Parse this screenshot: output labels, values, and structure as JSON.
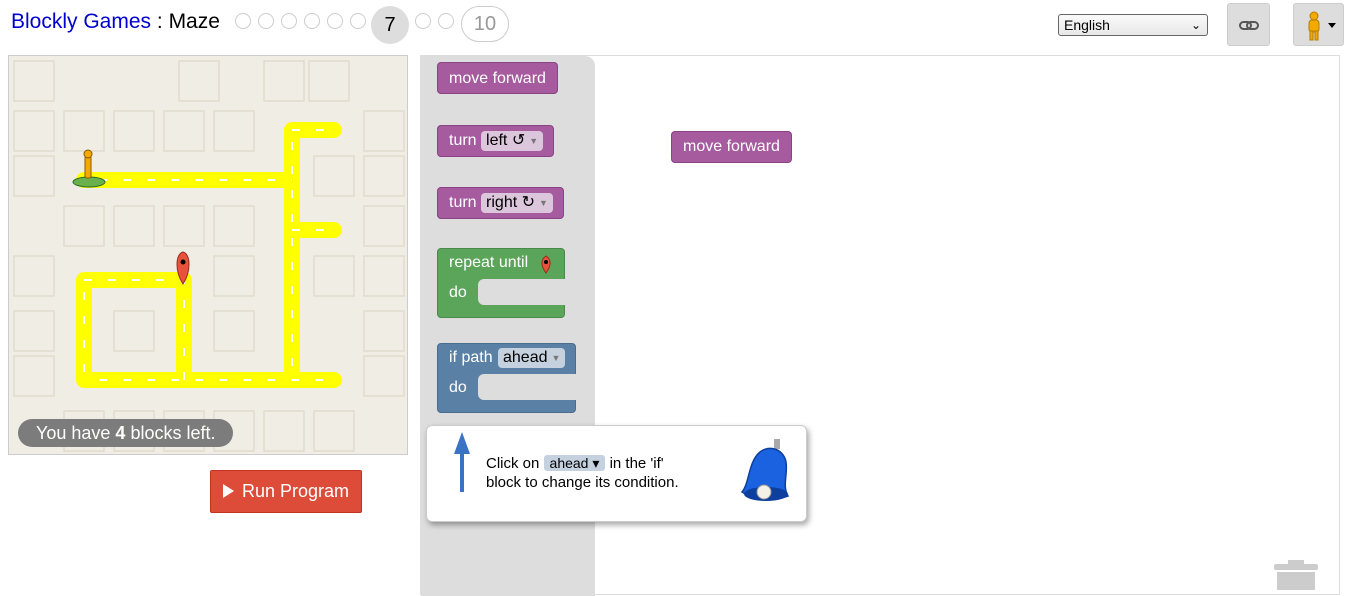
{
  "header": {
    "app_title": "Blockly Games",
    "separator": " : ",
    "game_name": "Maze",
    "current_level": "7",
    "last_level": "10",
    "language": "English"
  },
  "maze": {
    "capacity_prefix": "You have ",
    "capacity_count": "4",
    "capacity_suffix": " blocks left."
  },
  "run_button": {
    "label": "Run Program"
  },
  "toolbox": {
    "move_forward": "move forward",
    "turn_label": "turn",
    "turn_left_option": "left ↺",
    "turn_right_option": "right ↻",
    "repeat_until": "repeat until",
    "do_label": "do",
    "if_path": "if path",
    "if_option": "ahead"
  },
  "workspace": {
    "placed_block": "move forward"
  },
  "hint": {
    "before": "Click on",
    "chip": "ahead ▾",
    "after": "in the 'if'",
    "line2": "block to change its condition."
  },
  "colors": {
    "motion_block": "#a55b9e",
    "loop_block": "#5ba55b",
    "logic_block": "#5b80a5",
    "path": "#ffff00",
    "run_button": "#dd4b39"
  }
}
